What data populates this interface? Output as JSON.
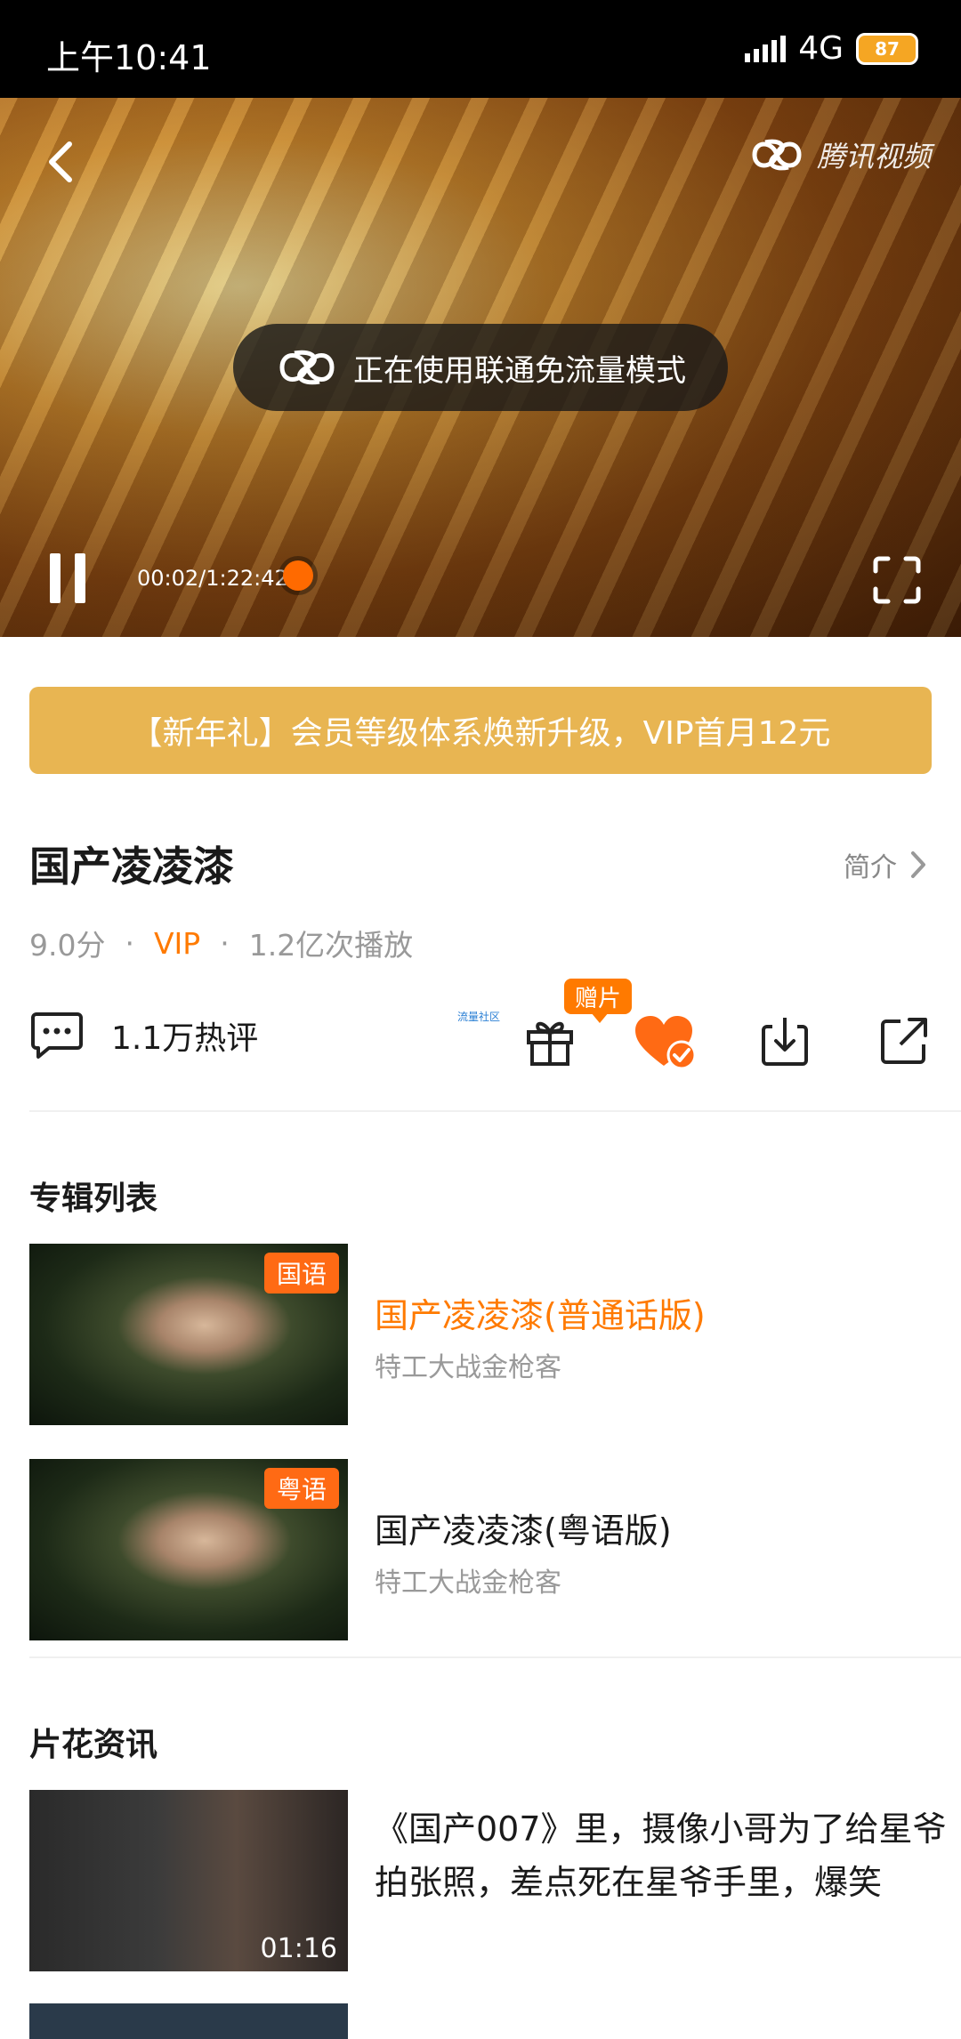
{
  "status_bar": {
    "time": "上午10:41",
    "network": "4G",
    "battery": "87"
  },
  "player": {
    "logo_text": "腾讯视频",
    "toast": "正在使用联通免流量模式",
    "time": "00:02/1:22:42",
    "progress": 0.0004
  },
  "banner": "【新年礼】会员等级体系焕新升级，VIP首月12元",
  "video": {
    "title": "国产凌凌漆",
    "intro_label": "简介",
    "score": "9.0分",
    "vip": "VIP",
    "plays": "1.2亿次播放",
    "comments": "1.1万热评",
    "tiny_label": "流量社区",
    "gift_badge": "赠片"
  },
  "album": {
    "title": "专辑列表",
    "items": [
      {
        "tag": "国语",
        "title": "国产凌凌漆(普通话版)",
        "subtitle": "特工大战金枪客",
        "active": true
      },
      {
        "tag": "粤语",
        "title": "国产凌凌漆(粤语版)",
        "subtitle": "特工大战金枪客",
        "active": false
      }
    ]
  },
  "news": {
    "title": "片花资讯",
    "items": [
      {
        "title": "《国产007》里，摄像小哥为了给星爷拍张照，差点死在星爷手里，爆笑",
        "duration": "01:16"
      }
    ]
  },
  "colors": {
    "accent": "#ff7a00",
    "banner": "#e8b552"
  }
}
